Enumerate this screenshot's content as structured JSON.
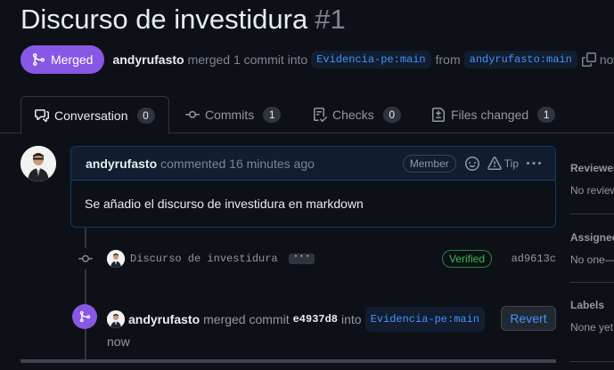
{
  "pr": {
    "title": "Discurso de investidura",
    "number": "#1",
    "state": "Merged",
    "author": "andyrufasto",
    "merge_text": "merged 1 commit into",
    "base_branch": "Evidencia-pe:main",
    "from_text": "from",
    "head_branch": "andyrufasto:main",
    "time": "now"
  },
  "tabs": [
    {
      "label": "Conversation",
      "count": "0",
      "icon": "comment-discussion-icon"
    },
    {
      "label": "Commits",
      "count": "1",
      "icon": "git-commit-icon"
    },
    {
      "label": "Checks",
      "count": "0",
      "icon": "checklist-icon"
    },
    {
      "label": "Files changed",
      "count": "1",
      "icon": "file-diff-icon"
    }
  ],
  "comment": {
    "author": "andyrufasto",
    "action": "commented 16 minutes ago",
    "role": "Member",
    "tip_label": "Tip",
    "body": "Se añadio el discurso de investidura en markdown"
  },
  "commit": {
    "message": "Discurso de investidura",
    "ellipsis": "···",
    "verified": "Verified",
    "sha": "ad9613c"
  },
  "merge_event": {
    "author": "andyrufasto",
    "text": "merged commit",
    "sha": "e4937d8",
    "into": "into",
    "branch": "Evidencia-pe:main",
    "time": "now",
    "revert_label": "Revert"
  },
  "sidebar": {
    "reviewers": {
      "title": "Reviewers",
      "value": "No reviews"
    },
    "assignees": {
      "title": "Assignees",
      "value": "No one—"
    },
    "labels": {
      "title": "Labels",
      "value": "None yet"
    }
  },
  "colors": {
    "merged": "#8957e5",
    "link": "#4493f8",
    "verified": "#3fb950",
    "background": "#0d1117"
  }
}
